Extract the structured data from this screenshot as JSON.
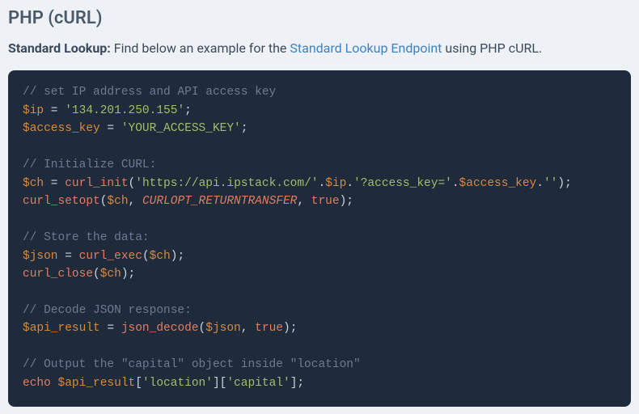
{
  "title": "PHP (cURL)",
  "lead": {
    "bold": "Standard Lookup:",
    "before_link": " Find below an example for the ",
    "link_text": "Standard Lookup Endpoint",
    "after_link": " using PHP cURL."
  },
  "code": {
    "c1": "// set IP address and API access key",
    "v_ip": "$ip",
    "eq": " = ",
    "s_ip": "'134.201.250.155'",
    "semi": ";",
    "v_ak": "$access_key",
    "s_ak": "'YOUR_ACCESS_KEY'",
    "c2": "// Initialize CURL:",
    "v_ch": "$ch",
    "f_init": "curl_init",
    "po": "(",
    "pc": ")",
    "s_url": "'https://api.ipstack.com/'",
    "dot": ".",
    "s_q": "'?access_key='",
    "s_empty": "''",
    "f_setopt": "curl_setopt",
    "comma": ", ",
    "k_const": "CURLOPT_RETURNTRANSFER",
    "k_true": "true",
    "c3": "// Store the data:",
    "v_json": "$json",
    "f_exec": "curl_exec",
    "f_close": "curl_close",
    "c4": "// Decode JSON response:",
    "v_api": "$api_result",
    "f_decode": "json_decode",
    "c5": "// Output the \"capital\" object inside \"location\"",
    "k_echo": "echo",
    "sp": " ",
    "lb": "[",
    "rb": "]",
    "s_loc": "'location'",
    "s_cap": "'capital'"
  }
}
